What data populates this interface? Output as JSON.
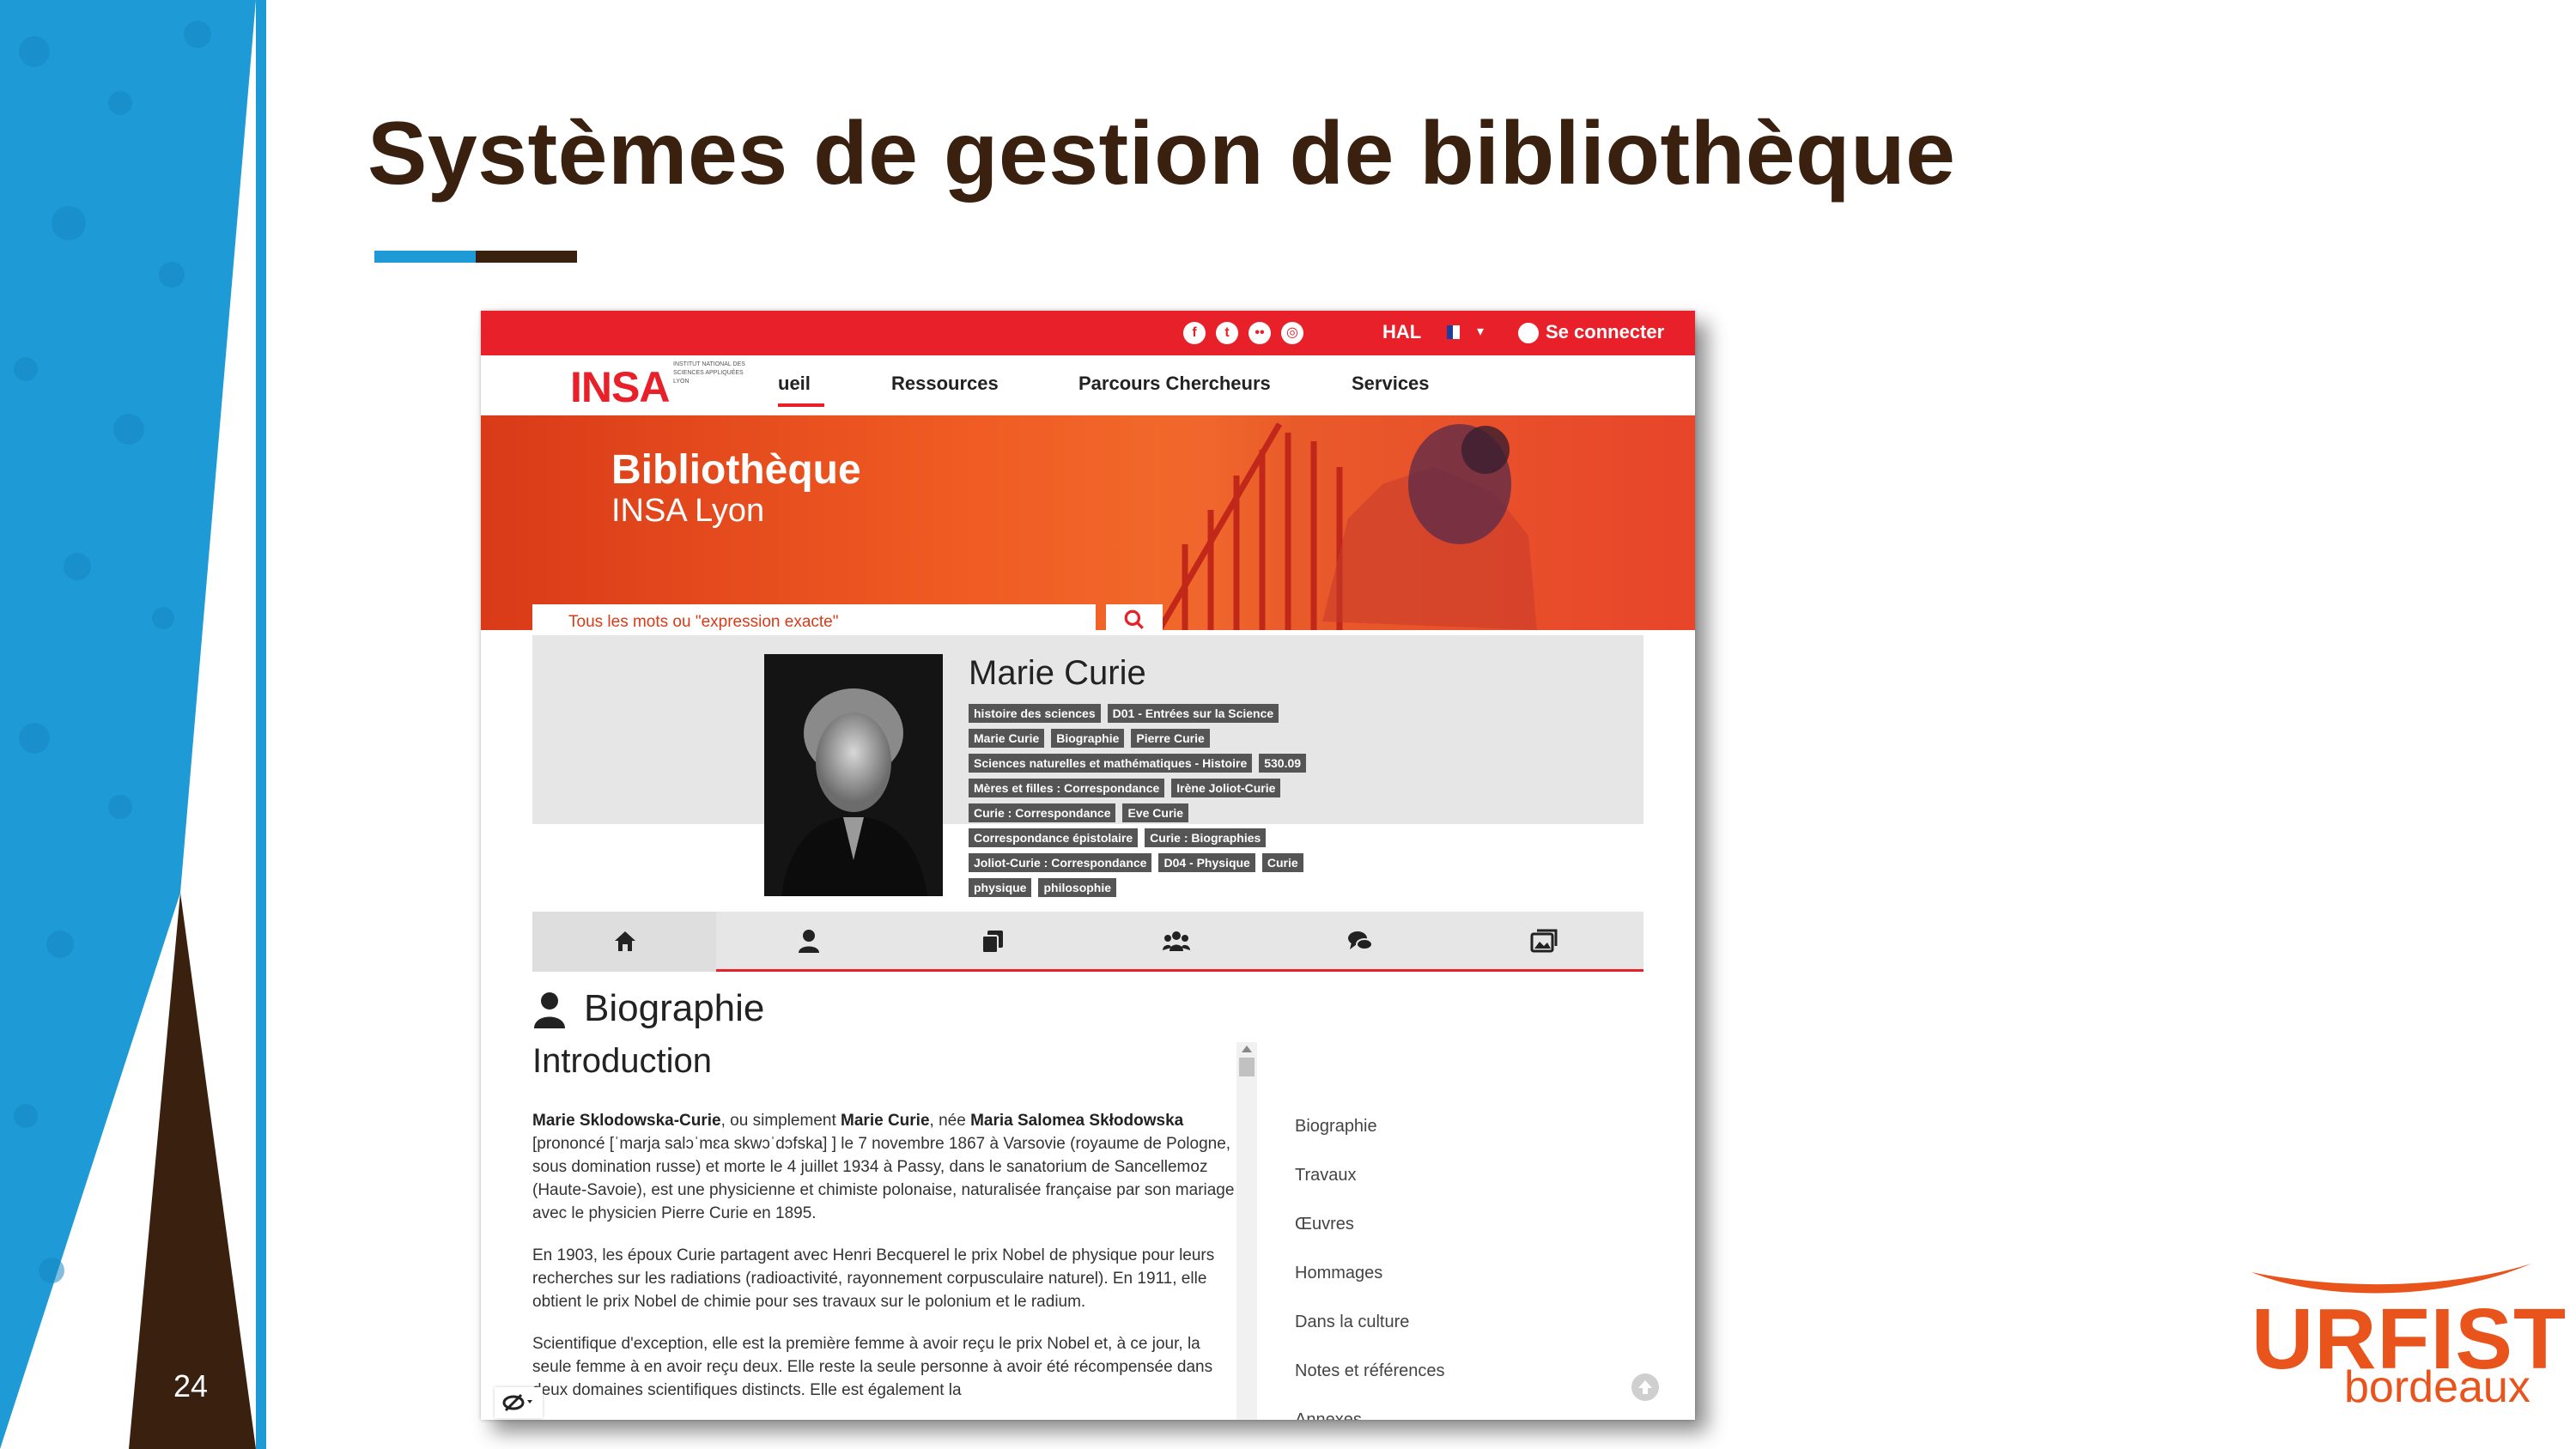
{
  "slide": {
    "title": "Systèmes de gestion de bibliothèque",
    "page_number": "24",
    "accent_blue": "#1e9ad6",
    "accent_brown": "#3a200e",
    "logo": {
      "brand": "URFIST",
      "city": "bordeaux",
      "color": "#e8541c"
    }
  },
  "site": {
    "accent": "#e8202a",
    "topbar": {
      "social_icons": [
        "facebook-icon",
        "twitter-icon",
        "flickr-icon",
        "instagram-icon"
      ],
      "hal_label": "HAL",
      "language_flag": "french-flag-icon",
      "login_label": "Se connecter"
    },
    "logo": {
      "text": "INSA",
      "subtitle": "INSTITUT NATIONAL DES SCIENCES APPLIQUÉES LYON"
    },
    "nav": {
      "home": "ueil",
      "resources": "Ressources",
      "researchers": "Parcours Chercheurs",
      "services": "Services"
    },
    "hero": {
      "title": "Bibliothèque",
      "subtitle": "INSA Lyon"
    },
    "search": {
      "placeholder": "Tous les mots ou \"expression exacte\""
    },
    "profile": {
      "name": "Marie Curie",
      "tag_rows": [
        [
          "histoire des sciences",
          "D01 - Entrées sur la Science"
        ],
        [
          "Marie Curie",
          "Biographie",
          "Pierre Curie"
        ],
        [
          "Sciences naturelles et mathématiques - Histoire",
          "530.09"
        ],
        [
          "Mères et filles : Correspondance",
          "Irène Joliot-Curie"
        ],
        [
          "Curie : Correspondance",
          "Eve Curie"
        ],
        [
          "Correspondance épistolaire",
          "Curie : Biographies"
        ],
        [
          "Joliot-Curie : Correspondance",
          "D04 - Physique",
          "Curie"
        ],
        [
          "physique",
          "philosophie"
        ]
      ]
    },
    "tabs": [
      "home-icon",
      "person-icon",
      "documents-icon",
      "group-icon",
      "comments-icon",
      "images-icon"
    ],
    "section": {
      "title": "Biographie",
      "intro": "Introduction",
      "p1": {
        "name1": "Marie Sklodowska-Curie",
        "t1": ", ou simplement ",
        "name2": "Marie Curie",
        "t2": ", née ",
        "name3": "Maria Salomea Skłodowska",
        "t3": " [prononcé [ˈmarja salɔˈmɛa skwɔˈdɔfska] ] le 7 novembre 1867 à Varsovie (royaume de Pologne, sous domination russe) et morte le 4 juillet 1934 à Passy, dans le sanatorium de Sancellemoz (Haute-Savoie), est une physicienne et chimiste polonaise, naturalisée française par son mariage avec le physicien Pierre Curie en 1895."
      },
      "p2": "En 1903, les époux Curie partagent avec Henri Becquerel le prix Nobel de physique pour leurs recherches sur les radiations (radioactivité, rayonnement corpusculaire naturel). En 1911, elle obtient le prix Nobel de chimie pour ses travaux sur le polonium et le radium.",
      "p3": "Scientifique d'exception, elle est la première femme à avoir reçu le prix Nobel et, à ce jour, la seule femme à en avoir reçu deux. Elle reste la seule personne à avoir été récompensée dans deux domaines scientifiques distincts. Elle est également la"
    },
    "toc": [
      "Biographie",
      "Travaux",
      "Œuvres",
      "Hommages",
      "Dans la culture",
      "Notes et références",
      "Annexes"
    ]
  }
}
